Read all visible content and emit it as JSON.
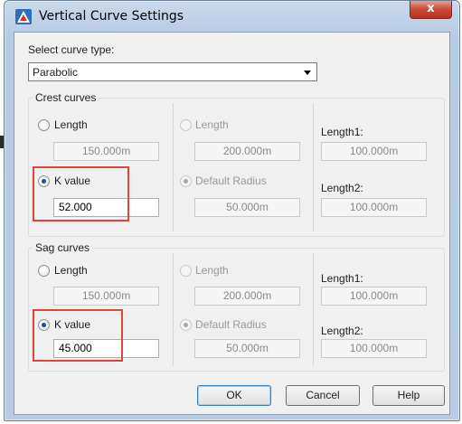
{
  "window": {
    "title": "Vertical Curve Settings",
    "close_label": "x"
  },
  "curve_type": {
    "label": "Select curve type:",
    "value": "Parabolic"
  },
  "crest": {
    "title": "Crest curves",
    "length_label": "Length",
    "length_value": "150.000m",
    "k_label": "K value",
    "k_value": "52.000",
    "mid_length_label": "Length",
    "mid_length_value": "200.000m",
    "default_radius_label": "Default Radius",
    "default_radius_value": "50.000m",
    "length1_label": "Length1:",
    "length1_value": "100.000m",
    "length2_label": "Length2:",
    "length2_value": "100.000m"
  },
  "sag": {
    "title": "Sag curves",
    "length_label": "Length",
    "length_value": "150.000m",
    "k_label": "K value",
    "k_value": "45.000",
    "mid_length_label": "Length",
    "mid_length_value": "200.000m",
    "default_radius_label": "Default Radius",
    "default_radius_value": "50.000m",
    "length1_label": "Length1:",
    "length1_value": "100.000m",
    "length2_label": "Length2:",
    "length2_value": "100.000m"
  },
  "buttons": {
    "ok": "OK",
    "cancel": "Cancel",
    "help": "Help"
  },
  "colors": {
    "highlight": "#e0453c",
    "radio_checked": "#1d4fa0"
  }
}
